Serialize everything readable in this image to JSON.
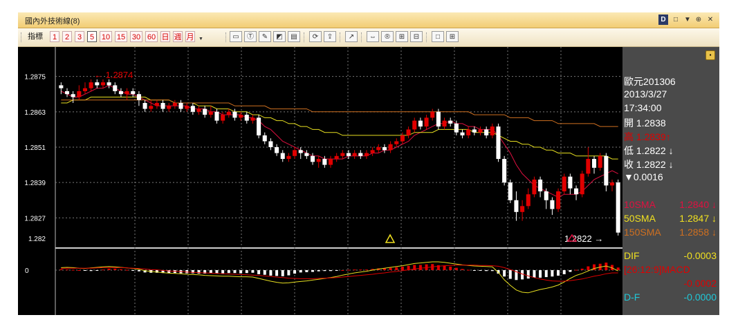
{
  "window": {
    "title": "國內外技術線(8)",
    "controls": [
      "D",
      "□",
      "▼",
      "⊕",
      "✕"
    ]
  },
  "toolbar": {
    "indicator_label": "指標",
    "periods": [
      "1",
      "2",
      "3",
      "5",
      "10",
      "15",
      "30",
      "60",
      "日",
      "週",
      "月"
    ],
    "selected_period": "5",
    "tool_icons": [
      "line-tool-icon",
      "text-tool-icon",
      "pen-tool-icon",
      "erase-tool-icon",
      "print-icon",
      "refresh-icon",
      "export-icon",
      "chart-type-icon",
      "fit-width-icon",
      "reset-zoom-icon",
      "zoom-in-icon",
      "zoom-out-icon",
      "single-pane-icon",
      "grid-pane-icon"
    ]
  },
  "chart_data": {
    "type": "candlestick",
    "symbol": "歐元201306",
    "y_ticks": [
      "1.2875",
      "1.2863",
      "1.2851",
      "1.2839",
      "1.2827",
      "1.282"
    ],
    "ylim": [
      1.2817,
      1.2885
    ],
    "grid": true,
    "max_annotation": "← 1.2874",
    "last_price_annotation": "1.2822 →",
    "macd_zero_label": "0",
    "candles": [
      [
        1.2872,
        1.2871,
        1.2873,
        1.2869
      ],
      [
        1.287,
        1.2869,
        1.2871,
        1.2868
      ],
      [
        1.2869,
        1.2868,
        1.287,
        1.2866
      ],
      [
        1.2868,
        1.287,
        1.2872,
        1.2867
      ],
      [
        1.287,
        1.2871,
        1.2873,
        1.2869
      ],
      [
        1.2871,
        1.2873,
        1.2874,
        1.287
      ],
      [
        1.2873,
        1.2872,
        1.2874,
        1.2871
      ],
      [
        1.2872,
        1.2873,
        1.2874,
        1.2871
      ],
      [
        1.2873,
        1.2872,
        1.2874,
        1.2871
      ],
      [
        1.2872,
        1.287,
        1.2873,
        1.2869
      ],
      [
        1.287,
        1.2869,
        1.2871,
        1.2868
      ],
      [
        1.2869,
        1.287,
        1.2871,
        1.2867
      ],
      [
        1.287,
        1.2869,
        1.2871,
        1.2868
      ],
      [
        1.2869,
        1.2867,
        1.287,
        1.2865
      ],
      [
        1.2866,
        1.2864,
        1.2867,
        1.2863
      ],
      [
        1.2864,
        1.2865,
        1.2867,
        1.2863
      ],
      [
        1.2865,
        1.2866,
        1.2867,
        1.2864
      ],
      [
        1.2866,
        1.2864,
        1.2867,
        1.2863
      ],
      [
        1.2864,
        1.2865,
        1.2866,
        1.2863
      ],
      [
        1.2865,
        1.2866,
        1.2867,
        1.2864
      ],
      [
        1.2866,
        1.2864,
        1.2867,
        1.2863
      ],
      [
        1.2864,
        1.2865,
        1.2866,
        1.2863
      ],
      [
        1.2865,
        1.2863,
        1.2866,
        1.2862
      ],
      [
        1.2863,
        1.2864,
        1.2865,
        1.2862
      ],
      [
        1.2864,
        1.2862,
        1.2865,
        1.2861
      ],
      [
        1.2862,
        1.2863,
        1.2865,
        1.2861
      ],
      [
        1.2863,
        1.286,
        1.2864,
        1.2859
      ],
      [
        1.286,
        1.2862,
        1.2863,
        1.2859
      ],
      [
        1.2862,
        1.2863,
        1.2864,
        1.2861
      ],
      [
        1.2863,
        1.2861,
        1.2864,
        1.286
      ],
      [
        1.2861,
        1.2862,
        1.2863,
        1.286
      ],
      [
        1.2862,
        1.286,
        1.2863,
        1.2859
      ],
      [
        1.286,
        1.2861,
        1.2862,
        1.2859
      ],
      [
        1.2861,
        1.2855,
        1.2862,
        1.2854
      ],
      [
        1.2855,
        1.2853,
        1.2856,
        1.2852
      ],
      [
        1.2853,
        1.2851,
        1.2854,
        1.285
      ],
      [
        1.2851,
        1.2849,
        1.2852,
        1.2848
      ],
      [
        1.2849,
        1.2847,
        1.285,
        1.2846
      ],
      [
        1.2847,
        1.2848,
        1.2849,
        1.2846
      ],
      [
        1.2848,
        1.285,
        1.2851,
        1.2847
      ],
      [
        1.285,
        1.2849,
        1.2851,
        1.2847
      ],
      [
        1.2849,
        1.2848,
        1.285,
        1.2847
      ],
      [
        1.2848,
        1.2846,
        1.2849,
        1.2845
      ],
      [
        1.2846,
        1.2847,
        1.2848,
        1.2844
      ],
      [
        1.2847,
        1.2845,
        1.2848,
        1.2844
      ],
      [
        1.2845,
        1.2847,
        1.2848,
        1.2844
      ],
      [
        1.2847,
        1.2848,
        1.2849,
        1.2846
      ],
      [
        1.2848,
        1.2849,
        1.285,
        1.2847
      ],
      [
        1.2849,
        1.2848,
        1.285,
        1.2847
      ],
      [
        1.2848,
        1.2849,
        1.285,
        1.2847
      ],
      [
        1.2849,
        1.2848,
        1.285,
        1.2847
      ],
      [
        1.2848,
        1.2849,
        1.285,
        1.2847
      ],
      [
        1.2849,
        1.285,
        1.2851,
        1.2848
      ],
      [
        1.285,
        1.2851,
        1.2852,
        1.2849
      ],
      [
        1.2851,
        1.285,
        1.2852,
        1.2849
      ],
      [
        1.285,
        1.2852,
        1.2853,
        1.2849
      ],
      [
        1.2852,
        1.2853,
        1.2854,
        1.2851
      ],
      [
        1.2853,
        1.2855,
        1.2856,
        1.2852
      ],
      [
        1.2855,
        1.2857,
        1.2858,
        1.2854
      ],
      [
        1.2857,
        1.286,
        1.2861,
        1.2856
      ],
      [
        1.286,
        1.2858,
        1.2861,
        1.2857
      ],
      [
        1.2858,
        1.2861,
        1.2862,
        1.2857
      ],
      [
        1.2861,
        1.2863,
        1.2864,
        1.286
      ],
      [
        1.2863,
        1.2858,
        1.2864,
        1.2857
      ],
      [
        1.2858,
        1.286,
        1.2861,
        1.2857
      ],
      [
        1.286,
        1.2859,
        1.2861,
        1.2858
      ],
      [
        1.2859,
        1.2856,
        1.286,
        1.2855
      ],
      [
        1.2856,
        1.2855,
        1.2857,
        1.2854
      ],
      [
        1.2855,
        1.2857,
        1.2858,
        1.2854
      ],
      [
        1.2857,
        1.2856,
        1.2858,
        1.2855
      ],
      [
        1.2856,
        1.2857,
        1.2858,
        1.2855
      ],
      [
        1.2857,
        1.2855,
        1.2858,
        1.2854
      ],
      [
        1.2855,
        1.2858,
        1.2859,
        1.2854
      ],
      [
        1.2858,
        1.2847,
        1.2859,
        1.2846
      ],
      [
        1.2847,
        1.2839,
        1.2848,
        1.2838
      ],
      [
        1.2839,
        1.2833,
        1.284,
        1.2832
      ],
      [
        1.2833,
        1.2829,
        1.2836,
        1.2826
      ],
      [
        1.2829,
        1.2831,
        1.2833,
        1.2826
      ],
      [
        1.2831,
        1.2835,
        1.2837,
        1.283
      ],
      [
        1.2835,
        1.284,
        1.2841,
        1.2834
      ],
      [
        1.284,
        1.2836,
        1.2841,
        1.2834
      ],
      [
        1.2836,
        1.2833,
        1.2837,
        1.283
      ],
      [
        1.2833,
        1.283,
        1.2834,
        1.2828
      ],
      [
        1.283,
        1.2836,
        1.2837,
        1.2829
      ],
      [
        1.2836,
        1.2841,
        1.2842,
        1.2835
      ],
      [
        1.2841,
        1.2837,
        1.2842,
        1.2835
      ],
      [
        1.2837,
        1.2835,
        1.2838,
        1.2833
      ],
      [
        1.2835,
        1.2842,
        1.2843,
        1.2834
      ],
      [
        1.2842,
        1.2847,
        1.2851,
        1.2841
      ],
      [
        1.2847,
        1.2844,
        1.2848,
        1.2842
      ],
      [
        1.2844,
        1.2848,
        1.2849,
        1.2843
      ],
      [
        1.2848,
        1.2838,
        1.2849,
        1.2836
      ],
      [
        1.2838,
        1.2839,
        1.284,
        1.2836
      ],
      [
        1.2839,
        1.2822,
        1.284,
        1.2821
      ]
    ],
    "series": [
      {
        "name": "10SMA",
        "color": "#e01040",
        "values": [
          1.287,
          1.2869,
          1.2868,
          1.2868,
          1.2869,
          1.287,
          1.2871,
          1.2871,
          1.2872,
          1.2871,
          1.287,
          1.2869,
          1.2869,
          1.2868,
          1.2867,
          1.2866,
          1.2865,
          1.2865,
          1.2865,
          1.2865,
          1.2865,
          1.2865,
          1.2864,
          1.2864,
          1.2864,
          1.2863,
          1.2863,
          1.2862,
          1.2862,
          1.2862,
          1.2862,
          1.2861,
          1.2861,
          1.286,
          1.2858,
          1.2857,
          1.2855,
          1.2853,
          1.2852,
          1.2851,
          1.285,
          1.2849,
          1.2848,
          1.2848,
          1.2847,
          1.2847,
          1.2847,
          1.2847,
          1.2848,
          1.2848,
          1.2848,
          1.2848,
          1.2849,
          1.2849,
          1.285,
          1.285,
          1.2851,
          1.2852,
          1.2853,
          1.2855,
          1.2856,
          1.2857,
          1.2858,
          1.2859,
          1.2859,
          1.286,
          1.2859,
          1.2859,
          1.2858,
          1.2858,
          1.2857,
          1.2857,
          1.2857,
          1.2855,
          1.2852,
          1.2849,
          1.2845,
          1.2842,
          1.284,
          1.2838,
          1.2837,
          1.2836,
          1.2835,
          1.2834,
          1.2835,
          1.2835,
          1.2835,
          1.2836,
          1.2838,
          1.284,
          1.2841,
          1.2842,
          1.2843,
          1.2842
        ]
      },
      {
        "name": "50SMA",
        "color": "#e8e020",
        "values": [
          1.2866,
          1.2866,
          1.2867,
          1.2867,
          1.2867,
          1.2868,
          1.2868,
          1.2868,
          1.2868,
          1.2868,
          1.2868,
          1.2868,
          1.2868,
          1.2868,
          1.2868,
          1.2867,
          1.2867,
          1.2867,
          1.2867,
          1.2866,
          1.2866,
          1.2866,
          1.2866,
          1.2865,
          1.2865,
          1.2865,
          1.2864,
          1.2864,
          1.2864,
          1.2863,
          1.2863,
          1.2863,
          1.2862,
          1.2862,
          1.2861,
          1.2861,
          1.286,
          1.286,
          1.2859,
          1.2859,
          1.2858,
          1.2858,
          1.2857,
          1.2857,
          1.2856,
          1.2856,
          1.2856,
          1.2855,
          1.2855,
          1.2855,
          1.2855,
          1.2855,
          1.2855,
          1.2855,
          1.2855,
          1.2855,
          1.2855,
          1.2855,
          1.2855,
          1.2856,
          1.2856,
          1.2856,
          1.2856,
          1.2857,
          1.2857,
          1.2857,
          1.2857,
          1.2857,
          1.2857,
          1.2856,
          1.2856,
          1.2856,
          1.2856,
          1.2855,
          1.2854,
          1.2853,
          1.2853,
          1.2852,
          1.2852,
          1.2851,
          1.2851,
          1.285,
          1.285,
          1.2849,
          1.2849,
          1.2849,
          1.2848,
          1.2848,
          1.2848,
          1.2848,
          1.2848,
          1.2848,
          1.2847,
          1.2847
        ]
      },
      {
        "name": "150SMA",
        "color": "#d07020",
        "values": [
          1.2867,
          1.2867,
          1.2867,
          1.2867,
          1.2867,
          1.2867,
          1.2867,
          1.2867,
          1.2867,
          1.2867,
          1.2867,
          1.2867,
          1.2867,
          1.2867,
          1.2867,
          1.2867,
          1.2867,
          1.2867,
          1.2867,
          1.2866,
          1.2866,
          1.2866,
          1.2866,
          1.2866,
          1.2866,
          1.2866,
          1.2866,
          1.2866,
          1.2866,
          1.2865,
          1.2865,
          1.2865,
          1.2865,
          1.2865,
          1.2865,
          1.2864,
          1.2864,
          1.2864,
          1.2864,
          1.2864,
          1.2864,
          1.2864,
          1.2863,
          1.2863,
          1.2863,
          1.2863,
          1.2863,
          1.2863,
          1.2863,
          1.2863,
          1.2863,
          1.2863,
          1.2863,
          1.2863,
          1.2863,
          1.2863,
          1.2863,
          1.2863,
          1.2863,
          1.2863,
          1.2863,
          1.2863,
          1.2863,
          1.2863,
          1.2863,
          1.2863,
          1.2863,
          1.2863,
          1.2863,
          1.2862,
          1.2862,
          1.2862,
          1.2862,
          1.2862,
          1.2862,
          1.2861,
          1.2861,
          1.2861,
          1.2861,
          1.286,
          1.286,
          1.286,
          1.286,
          1.2859,
          1.2859,
          1.2859,
          1.2859,
          1.2859,
          1.2859,
          1.2859,
          1.2858,
          1.2858,
          1.2858,
          1.2858
        ]
      }
    ],
    "macd": {
      "hist": [
        0.3,
        0.2,
        0.1,
        0.0,
        -0.2,
        -0.3,
        -0.2,
        0.2,
        0.5,
        0.5,
        0.3,
        0.1,
        -0.1,
        -0.4,
        -0.8,
        -0.9,
        -0.9,
        -1.0,
        -1.0,
        -1.0,
        -1.1,
        -1.1,
        -1.1,
        -1.2,
        -1.2,
        -1.1,
        -1.2,
        -1.1,
        -1.0,
        -1.0,
        -1.1,
        -1.0,
        -0.9,
        -1.4,
        -1.6,
        -1.9,
        -2.0,
        -2.1,
        -1.8,
        -1.2,
        -0.8,
        -0.7,
        -0.6,
        -0.4,
        -0.3,
        -0.3,
        -0.2,
        0.0,
        0.1,
        0.2,
        0.2,
        0.2,
        0.4,
        0.6,
        0.6,
        0.8,
        1.0,
        1.2,
        1.5,
        1.8,
        1.8,
        2.0,
        2.1,
        1.7,
        1.5,
        1.2,
        0.8,
        0.4,
        0.1,
        -0.1,
        -0.2,
        -0.3,
        -0.3,
        -1.2,
        -2.2,
        -3.0,
        -3.4,
        -3.2,
        -2.9,
        -2.6,
        -2.6,
        -2.4,
        -2.2,
        -1.9,
        -1.4,
        -0.6,
        0.1,
        0.5,
        1.3,
        2.0,
        2.2,
        2.6,
        1.8,
        0.9
      ],
      "dif": [
        0.9,
        1.0,
        0.9,
        0.7,
        0.6,
        0.8,
        1.0,
        1.2,
        1.3,
        1.2,
        1.0,
        0.8,
        0.6,
        0.3,
        -0.2,
        -0.5,
        -0.7,
        -0.9,
        -1.1,
        -1.2,
        -1.3,
        -1.5,
        -1.6,
        -1.7,
        -1.9,
        -2.0,
        -2.1,
        -2.2,
        -2.2,
        -2.3,
        -2.4,
        -2.4,
        -2.5,
        -3.0,
        -3.5,
        -4.0,
        -4.4,
        -4.7,
        -4.6,
        -4.3,
        -4.1,
        -3.9,
        -3.6,
        -3.3,
        -3.0,
        -2.7,
        -2.3,
        -1.8,
        -1.4,
        -1.0,
        -0.7,
        -0.4,
        0.0,
        0.4,
        0.7,
        1.0,
        1.3,
        1.6,
        2.0,
        2.4,
        2.6,
        2.8,
        3.0,
        3.0,
        2.8,
        2.5,
        2.2,
        1.9,
        1.7,
        1.5,
        1.4,
        1.3,
        1.2,
        -0.8,
        -3.5,
        -5.5,
        -7.2,
        -8.0,
        -8.2,
        -7.6,
        -7.0,
        -6.6,
        -6.1,
        -5.4,
        -4.3,
        -3.0,
        -1.9,
        -1.2,
        -0.3,
        0.6,
        1.1,
        1.5,
        0.8,
        -0.3
      ],
      "macd": [
        0.6,
        0.7,
        0.7,
        0.7,
        0.7,
        0.7,
        0.8,
        0.9,
        0.9,
        0.9,
        0.9,
        0.8,
        0.7,
        0.6,
        0.4,
        0.2,
        0.1,
        -0.1,
        -0.3,
        -0.4,
        -0.5,
        -0.7,
        -0.8,
        -0.9,
        -1.0,
        -1.1,
        -1.2,
        -1.3,
        -1.4,
        -1.5,
        -1.6,
        -1.7,
        -1.8,
        -1.9,
        -2.1,
        -2.3,
        -2.5,
        -2.7,
        -2.9,
        -3.0,
        -3.1,
        -3.1,
        -3.1,
        -3.0,
        -2.9,
        -2.8,
        -2.7,
        -2.5,
        -2.3,
        -2.1,
        -1.9,
        -1.7,
        -1.5,
        -1.2,
        -1.0,
        -0.7,
        -0.5,
        -0.2,
        0.1,
        0.4,
        0.7,
        0.9,
        1.2,
        1.4,
        1.6,
        1.7,
        1.8,
        1.8,
        1.8,
        1.8,
        1.7,
        1.7,
        1.6,
        1.4,
        0.9,
        0.2,
        -0.6,
        -1.4,
        -2.1,
        -2.7,
        -3.2,
        -3.6,
        -3.9,
        -4.0,
        -4.0,
        -3.8,
        -3.5,
        -3.2,
        -2.7,
        -2.2,
        -1.8,
        -1.3,
        -1.0,
        -1.0
      ]
    }
  },
  "info_panel": {
    "symbol": "歐元201306",
    "date": "2013/3/27",
    "time": "17:34:00",
    "open_label": "開",
    "open_value": "1.2838",
    "high_label": "高",
    "high_value": "1.2839",
    "high_arrow": "↑",
    "low_label": "低",
    "low_value": "1.2822",
    "low_arrow": "↓",
    "close_label": "收",
    "close_value": "1.2822",
    "close_arrow": "↓",
    "change": "▼0.0016",
    "sma10_label": "10SMA",
    "sma10_value": "1.2840 ↓",
    "sma50_label": "50SMA",
    "sma50_value": "1.2847 ↓",
    "sma150_label": "150SMA",
    "sma150_value": "1.2858 ↓",
    "dif_label": "DIF",
    "dif_value": "-0.0003",
    "macd_label": "[26:12:9]MACD",
    "macd_value": "-0.0002",
    "df_label": "D-F",
    "df_value": "-0.0000"
  },
  "colors": {
    "up": "#e00000",
    "down": "#ffffff",
    "grid": "#7a7a7a",
    "sma10": "#e01040",
    "sma50": "#e8e020",
    "sma150": "#d07020",
    "df": "#20c8d8",
    "panel_bg": "#4a4a4a"
  }
}
